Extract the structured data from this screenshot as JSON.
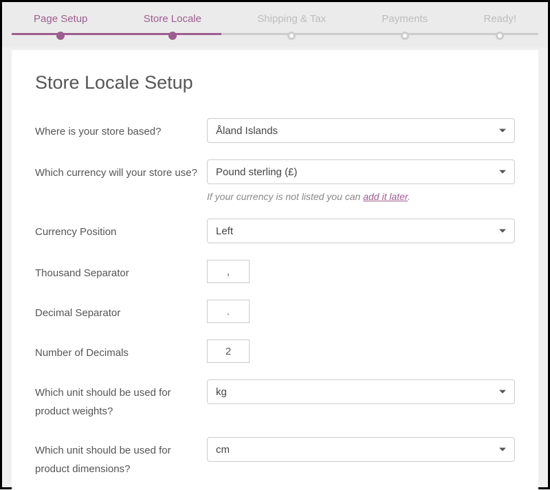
{
  "steps": {
    "0": {
      "label": "Page Setup"
    },
    "1": {
      "label": "Store Locale"
    },
    "2": {
      "label": "Shipping & Tax"
    },
    "3": {
      "label": "Payments"
    },
    "4": {
      "label": "Ready!"
    }
  },
  "page": {
    "title": "Store Locale Setup"
  },
  "form": {
    "country": {
      "label": "Where is your store based?",
      "value": "Åland Islands"
    },
    "currency": {
      "label": "Which currency will your store use?",
      "value": "Pound sterling (£)",
      "helper_pre": "If your currency is not listed you can ",
      "helper_link": "add it later",
      "helper_post": "."
    },
    "currency_position": {
      "label": "Currency Position",
      "value": "Left"
    },
    "thousand_sep": {
      "label": "Thousand Separator",
      "value": ","
    },
    "decimal_sep": {
      "label": "Decimal Separator",
      "value": "."
    },
    "num_decimals": {
      "label": "Number of Decimals",
      "value": "2"
    },
    "weight_unit": {
      "label": "Which unit should be used for product weights?",
      "value": "kg"
    },
    "dimension_unit": {
      "label": "Which unit should be used for product dimensions?",
      "value": "cm"
    }
  }
}
